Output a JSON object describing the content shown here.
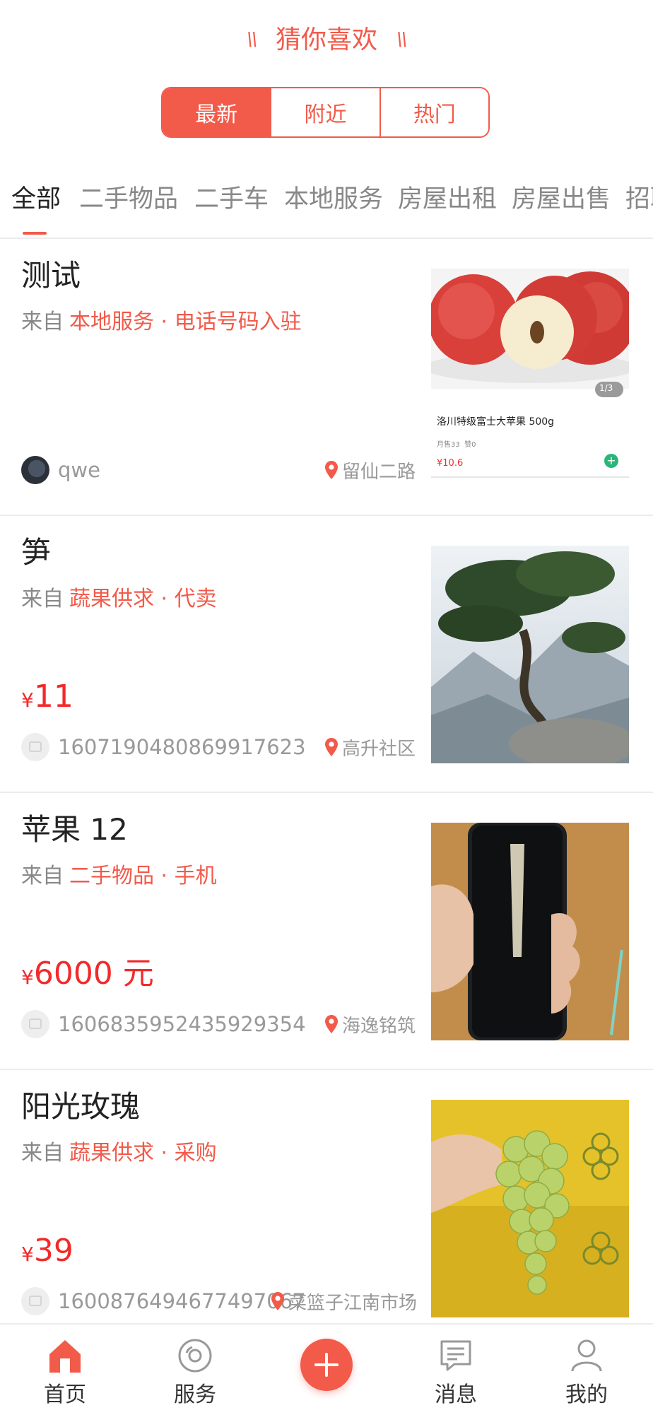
{
  "header": {
    "title": "猜你喜欢",
    "segments": [
      {
        "label": "最新",
        "active": true
      },
      {
        "label": "附近",
        "active": false
      },
      {
        "label": "热门",
        "active": false
      }
    ]
  },
  "categories": [
    "全部",
    "二手物品",
    "二手车",
    "本地服务",
    "房屋出租",
    "房屋出售",
    "招聘"
  ],
  "from_prefix": "来自",
  "items": [
    {
      "title": "测试",
      "category": "本地服务 · 电话号码入驻",
      "price_symbol": "",
      "price": "",
      "user": "qwe",
      "location": "留仙二路",
      "image": {
        "product_name": "洛川特级富士大苹果 500g",
        "meta": "月售33  赞0",
        "price": "¥10.6",
        "counter": "1/3"
      }
    },
    {
      "title": "笋",
      "category": "蔬果供求 · 代卖",
      "price_symbol": "¥",
      "price": "11",
      "user": "1607190480869917623",
      "location": "高升社区"
    },
    {
      "title": "苹果 12",
      "category": "二手物品 · 手机",
      "price_symbol": "¥",
      "price": "6000 元",
      "user": "1606835952435929354",
      "location": "海逸铭筑"
    },
    {
      "title": "阳光玫瑰",
      "category": "蔬果供求 · 采购",
      "price_symbol": "¥",
      "price": "39",
      "user": "1600876494677497067",
      "location": "菜篮子江南市场"
    }
  ],
  "tabbar": [
    {
      "label": "首页",
      "icon": "home-icon",
      "active": true
    },
    {
      "label": "服务",
      "icon": "service-icon",
      "active": false
    },
    {
      "label": "",
      "icon": "plus-icon",
      "active": false
    },
    {
      "label": "消息",
      "icon": "message-icon",
      "active": false
    },
    {
      "label": "我的",
      "icon": "profile-icon",
      "active": false
    }
  ],
  "colors": {
    "accent": "#f25a4a",
    "price": "#f22a2a",
    "muted": "#888888"
  }
}
